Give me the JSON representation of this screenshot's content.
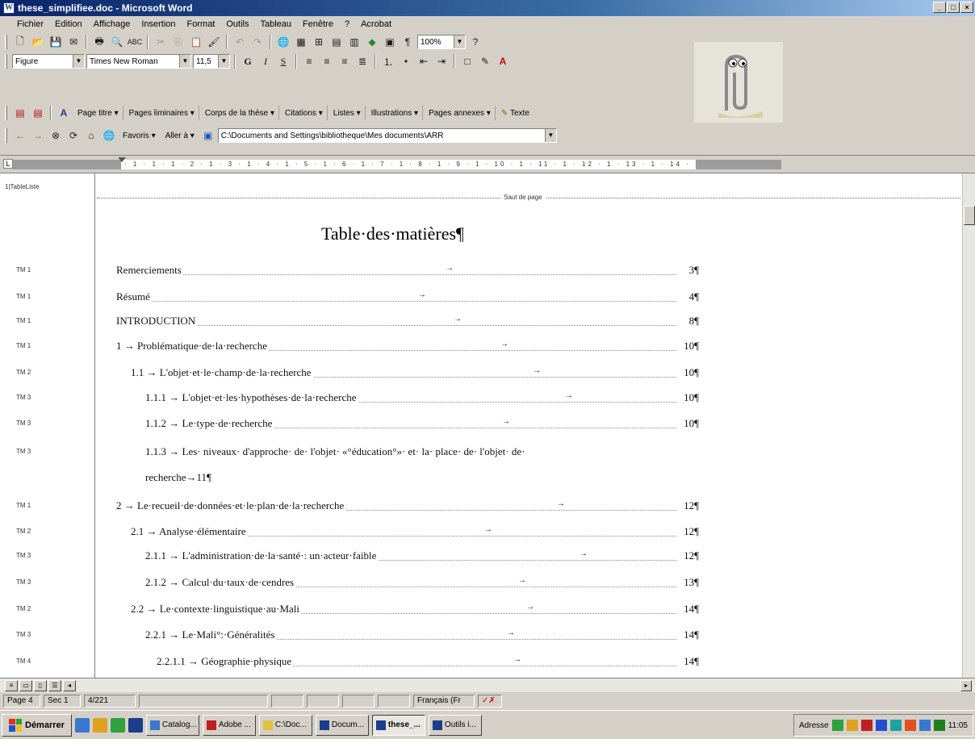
{
  "window": {
    "title": "these_simplifiee.doc - Microsoft Word"
  },
  "menu": [
    "Fichier",
    "Edition",
    "Affichage",
    "Insertion",
    "Format",
    "Outils",
    "Tableau",
    "Fenêtre",
    "?",
    "Acrobat"
  ],
  "formatting": {
    "style": "Figure",
    "font": "Times New Roman",
    "size": "11,5"
  },
  "standard": {
    "zoom": "100%"
  },
  "custom_toolbar": [
    "Page titre",
    "Pages liminaires",
    "Corps de la thèse",
    "Citations",
    "Listes",
    "Illustrations",
    "Pages annexes",
    "Texte"
  ],
  "web_toolbar": {
    "favorites": "Favoris",
    "goto": "Aller à",
    "address": "C:\\Documents and Settings\\bibliotheque\\Mes documents\\ARR"
  },
  "document": {
    "style_header": "1|TableListe",
    "page_break": "Saut de page",
    "toc_title": "Table·des·matières¶",
    "entries": [
      {
        "style": "TM 1",
        "label": "Remerciements",
        "page": "3¶"
      },
      {
        "style": "TM 1",
        "label": "Résumé",
        "page": "4¶"
      },
      {
        "style": "TM 1",
        "label": "INTRODUCTION",
        "page": "8¶"
      },
      {
        "style": "TM 1",
        "label": "1 → Problématique·de·la·recherche",
        "page": "10¶"
      },
      {
        "style": "TM 2",
        "label": "1.1 → L'objet·et·le·champ·de·la·recherche",
        "page": "10¶"
      },
      {
        "style": "TM 3",
        "label": "1.1.1 → L'objet·et·les·hypothèses·de·la·recherche",
        "page": "10¶"
      },
      {
        "style": "TM 3",
        "label": "1.1.2 → Le·type·de·recherche",
        "page": "10¶"
      },
      {
        "style": "TM 3",
        "label": "1.1.3 → Les· niveaux· d'approche· de· l'objet· «°éducation°»· et· la· place· de· l'objet· de·",
        "continuation": "recherche→11¶"
      },
      {
        "style": "TM 1",
        "label": "2 → Le·recueil·de·données·et·le·plan·de·la·recherche",
        "page": "12¶"
      },
      {
        "style": "TM 2",
        "label": "2.1 → Analyse·élémentaire",
        "page": "12¶"
      },
      {
        "style": "TM 3",
        "label": "2.1.1 → L'administration·de·la·santé·: un·acteur·faible",
        "page": "12¶"
      },
      {
        "style": "TM 3",
        "label": "2.1.2 → Calcul·du·taux·de·cendres",
        "page": "13¶"
      },
      {
        "style": "TM 2",
        "label": "2.2 → Le·contexte·linguistique·au·Mali",
        "page": "14¶"
      },
      {
        "style": "TM 3",
        "label": "2.2.1 → Le·Mali°:·Généralités",
        "page": "14¶"
      },
      {
        "style": "TM 4",
        "label": "2.2.1.1 → Géographie·physique",
        "page": "14¶"
      }
    ]
  },
  "status": {
    "page": "Page 4",
    "section": "Sec 1",
    "pages": "4/221",
    "language": "Français (Fr"
  },
  "taskbar": {
    "start": "Démarrer",
    "tasks": [
      "Catalog...",
      "Adobe ...",
      "C:\\Doc...",
      "Docum...",
      "these_...",
      "Outils i..."
    ],
    "address_label": "Adresse",
    "clock": "11:05"
  },
  "colors": {
    "titlebar": "#0a246a",
    "chrome": "#d4d0c8"
  }
}
